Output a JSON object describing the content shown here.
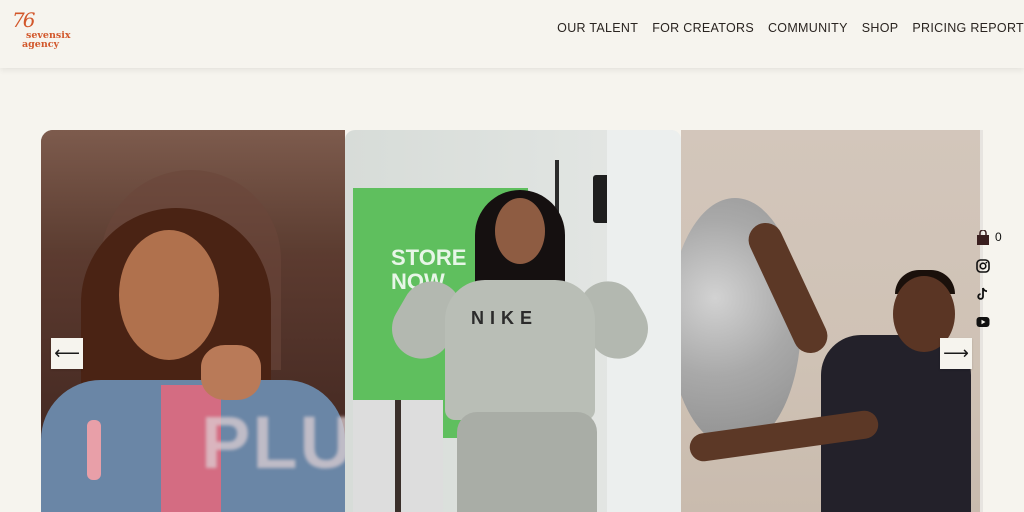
{
  "brand": {
    "logo_num": "76",
    "logo_line1": "sevensix",
    "logo_line2": "agency",
    "color": "#d2572b"
  },
  "nav": {
    "items": [
      {
        "label": "OUR TALENT"
      },
      {
        "label": "FOR CREATORS"
      },
      {
        "label": "COMMUNITY"
      },
      {
        "label": "SHOP"
      },
      {
        "label": "PRICING REPORT"
      }
    ]
  },
  "carousel": {
    "prev_arrow": "⟵",
    "next_arrow": "⟶",
    "slides": [
      {
        "overlay_text": "PLU"
      },
      {
        "sign_line1": "STORE",
        "sign_line2": "NOW",
        "shirt_text": "NIKE"
      },
      {}
    ]
  },
  "side_icons": {
    "cart_count": "0",
    "icons": [
      "bag-icon",
      "instagram-icon",
      "tiktok-icon",
      "youtube-icon"
    ]
  },
  "colors": {
    "background": "#f6f4ee",
    "accent": "#d2572b",
    "text": "#2a2420"
  }
}
